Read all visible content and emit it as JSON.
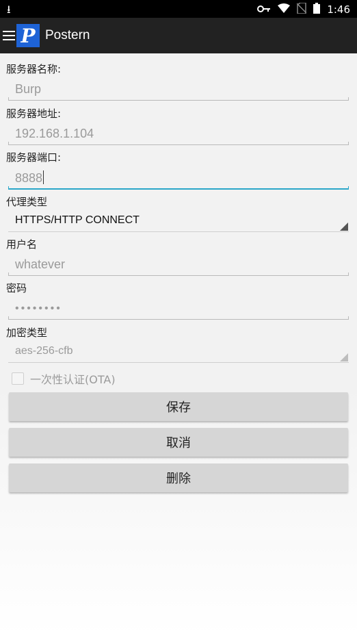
{
  "status_bar": {
    "time": "1:46",
    "icons": [
      "download-icon",
      "key-icon",
      "wifi-icon",
      "no-sim-icon",
      "battery-icon"
    ]
  },
  "app_bar": {
    "title": "Postern",
    "logo_letter": "P",
    "accent": "#1e63d6"
  },
  "form": {
    "server_name_label": "服务器名称:",
    "server_name_value": "Burp",
    "server_address_label": "服务器地址:",
    "server_address_value": "192.168.1.104",
    "server_port_label": "服务器端口:",
    "server_port_value": "8888",
    "proxy_type_label": "代理类型",
    "proxy_type_value": "HTTPS/HTTP CONNECT",
    "username_label": "用户名",
    "username_value": "whatever",
    "password_label": "密码",
    "password_value": "••••••••",
    "encryption_label": "加密类型",
    "encryption_value": "aes-256-cfb",
    "ota_label": "一次性认证(OTA)",
    "ota_checked": false,
    "focus_color": "#2aa6c9"
  },
  "buttons": {
    "save": "保存",
    "cancel": "取消",
    "delete": "删除"
  }
}
